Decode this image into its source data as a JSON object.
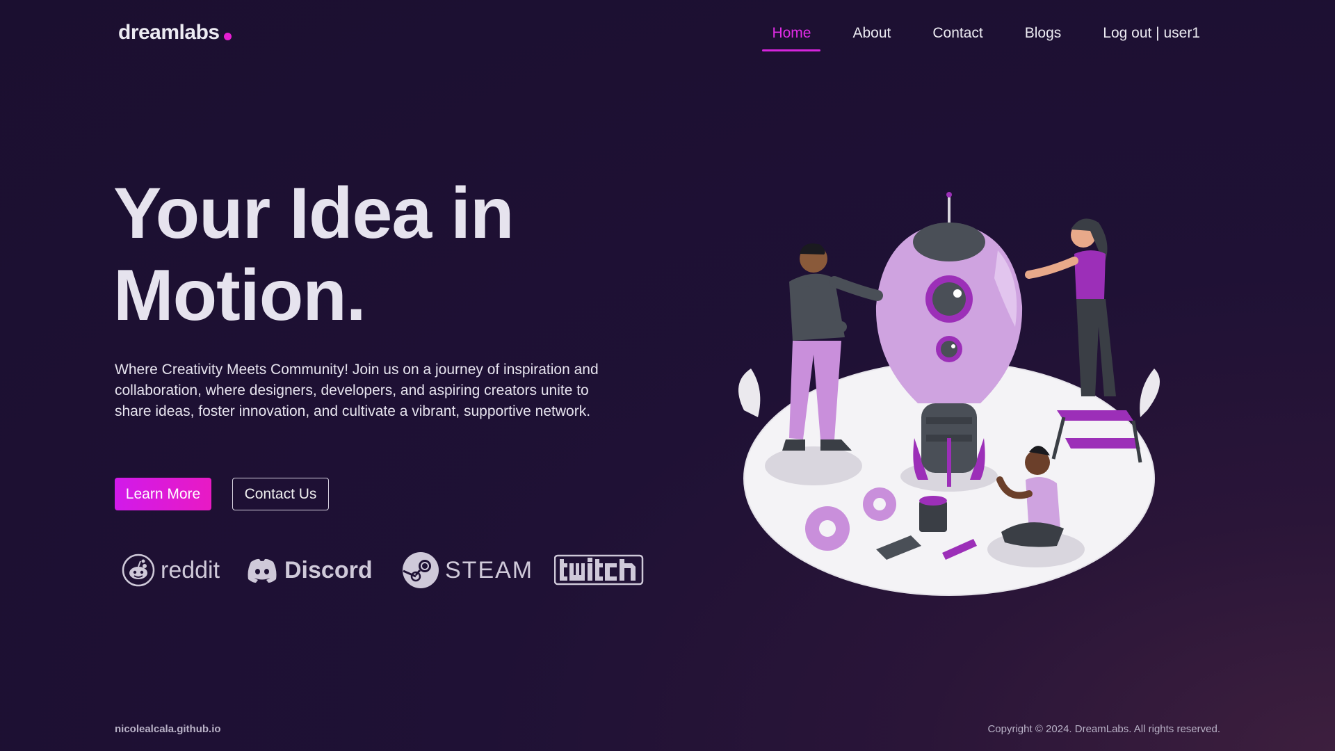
{
  "logo": {
    "text": "dreamlabs",
    "accent": "#e61ed2"
  },
  "nav": {
    "items": [
      {
        "label": "Home",
        "active": true
      },
      {
        "label": "About",
        "active": false
      },
      {
        "label": "Contact",
        "active": false
      },
      {
        "label": "Blogs",
        "active": false
      },
      {
        "label": "Log out | user1",
        "active": false
      }
    ]
  },
  "hero": {
    "title_line1": "Your Idea in",
    "title_line2": "Motion.",
    "description": "Where Creativity Meets Community! Join us on a journey of inspiration and collaboration, where designers, developers, and aspiring creators unite to share ideas, foster innovation, and cultivate a vibrant, supportive network.",
    "primary_button": "Learn More",
    "secondary_button": "Contact Us"
  },
  "brands": [
    {
      "name": "reddit",
      "icon": "reddit-icon"
    },
    {
      "name": "Discord",
      "icon": "discord-icon"
    },
    {
      "name": "STEAM",
      "icon": "steam-icon"
    },
    {
      "name": "twitch",
      "icon": "twitch-logo"
    }
  ],
  "footer": {
    "left": "nicolealcala.github.io",
    "right": "Copyright © 2024. DreamLabs. All rights reserved."
  },
  "colors": {
    "background": "#1e1134",
    "accent": "#e12ce6",
    "text": "#ecebf2"
  }
}
